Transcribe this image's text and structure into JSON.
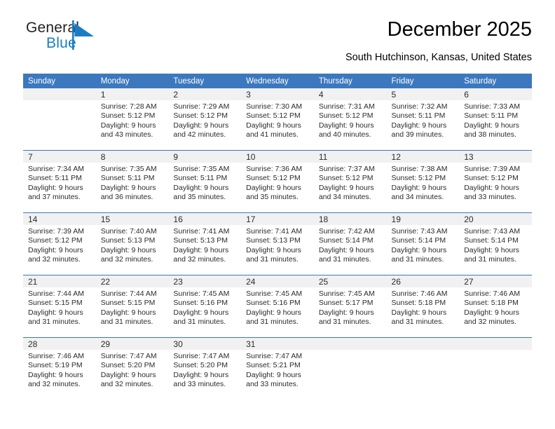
{
  "brand": {
    "name_part1": "General",
    "name_part2": "Blue",
    "logo_icon": "blue-triangle-flag-mark",
    "color_primary": "#1a7dc4",
    "color_dark": "#231f20"
  },
  "header": {
    "title": "December 2025",
    "subtitle": "South Hutchinson, Kansas, United States"
  },
  "calendar": {
    "header_bg": "#3c78be",
    "header_text_color": "#ffffff",
    "daynum_band_bg": "#f1f1f1",
    "row_divider_color": "#3c78be",
    "weekdays": [
      "Sunday",
      "Monday",
      "Tuesday",
      "Wednesday",
      "Thursday",
      "Friday",
      "Saturday"
    ],
    "weeks": [
      [
        {
          "day": "",
          "sunrise": "",
          "sunset": "",
          "daylight_line1": "",
          "daylight_line2": "",
          "empty": true
        },
        {
          "day": "1",
          "sunrise": "Sunrise: 7:28 AM",
          "sunset": "Sunset: 5:12 PM",
          "daylight_line1": "Daylight: 9 hours",
          "daylight_line2": "and 43 minutes."
        },
        {
          "day": "2",
          "sunrise": "Sunrise: 7:29 AM",
          "sunset": "Sunset: 5:12 PM",
          "daylight_line1": "Daylight: 9 hours",
          "daylight_line2": "and 42 minutes."
        },
        {
          "day": "3",
          "sunrise": "Sunrise: 7:30 AM",
          "sunset": "Sunset: 5:12 PM",
          "daylight_line1": "Daylight: 9 hours",
          "daylight_line2": "and 41 minutes."
        },
        {
          "day": "4",
          "sunrise": "Sunrise: 7:31 AM",
          "sunset": "Sunset: 5:12 PM",
          "daylight_line1": "Daylight: 9 hours",
          "daylight_line2": "and 40 minutes."
        },
        {
          "day": "5",
          "sunrise": "Sunrise: 7:32 AM",
          "sunset": "Sunset: 5:11 PM",
          "daylight_line1": "Daylight: 9 hours",
          "daylight_line2": "and 39 minutes."
        },
        {
          "day": "6",
          "sunrise": "Sunrise: 7:33 AM",
          "sunset": "Sunset: 5:11 PM",
          "daylight_line1": "Daylight: 9 hours",
          "daylight_line2": "and 38 minutes."
        }
      ],
      [
        {
          "day": "7",
          "sunrise": "Sunrise: 7:34 AM",
          "sunset": "Sunset: 5:11 PM",
          "daylight_line1": "Daylight: 9 hours",
          "daylight_line2": "and 37 minutes."
        },
        {
          "day": "8",
          "sunrise": "Sunrise: 7:35 AM",
          "sunset": "Sunset: 5:11 PM",
          "daylight_line1": "Daylight: 9 hours",
          "daylight_line2": "and 36 minutes."
        },
        {
          "day": "9",
          "sunrise": "Sunrise: 7:35 AM",
          "sunset": "Sunset: 5:11 PM",
          "daylight_line1": "Daylight: 9 hours",
          "daylight_line2": "and 35 minutes."
        },
        {
          "day": "10",
          "sunrise": "Sunrise: 7:36 AM",
          "sunset": "Sunset: 5:12 PM",
          "daylight_line1": "Daylight: 9 hours",
          "daylight_line2": "and 35 minutes."
        },
        {
          "day": "11",
          "sunrise": "Sunrise: 7:37 AM",
          "sunset": "Sunset: 5:12 PM",
          "daylight_line1": "Daylight: 9 hours",
          "daylight_line2": "and 34 minutes."
        },
        {
          "day": "12",
          "sunrise": "Sunrise: 7:38 AM",
          "sunset": "Sunset: 5:12 PM",
          "daylight_line1": "Daylight: 9 hours",
          "daylight_line2": "and 34 minutes."
        },
        {
          "day": "13",
          "sunrise": "Sunrise: 7:39 AM",
          "sunset": "Sunset: 5:12 PM",
          "daylight_line1": "Daylight: 9 hours",
          "daylight_line2": "and 33 minutes."
        }
      ],
      [
        {
          "day": "14",
          "sunrise": "Sunrise: 7:39 AM",
          "sunset": "Sunset: 5:12 PM",
          "daylight_line1": "Daylight: 9 hours",
          "daylight_line2": "and 32 minutes."
        },
        {
          "day": "15",
          "sunrise": "Sunrise: 7:40 AM",
          "sunset": "Sunset: 5:13 PM",
          "daylight_line1": "Daylight: 9 hours",
          "daylight_line2": "and 32 minutes."
        },
        {
          "day": "16",
          "sunrise": "Sunrise: 7:41 AM",
          "sunset": "Sunset: 5:13 PM",
          "daylight_line1": "Daylight: 9 hours",
          "daylight_line2": "and 32 minutes."
        },
        {
          "day": "17",
          "sunrise": "Sunrise: 7:41 AM",
          "sunset": "Sunset: 5:13 PM",
          "daylight_line1": "Daylight: 9 hours",
          "daylight_line2": "and 31 minutes."
        },
        {
          "day": "18",
          "sunrise": "Sunrise: 7:42 AM",
          "sunset": "Sunset: 5:14 PM",
          "daylight_line1": "Daylight: 9 hours",
          "daylight_line2": "and 31 minutes."
        },
        {
          "day": "19",
          "sunrise": "Sunrise: 7:43 AM",
          "sunset": "Sunset: 5:14 PM",
          "daylight_line1": "Daylight: 9 hours",
          "daylight_line2": "and 31 minutes."
        },
        {
          "day": "20",
          "sunrise": "Sunrise: 7:43 AM",
          "sunset": "Sunset: 5:14 PM",
          "daylight_line1": "Daylight: 9 hours",
          "daylight_line2": "and 31 minutes."
        }
      ],
      [
        {
          "day": "21",
          "sunrise": "Sunrise: 7:44 AM",
          "sunset": "Sunset: 5:15 PM",
          "daylight_line1": "Daylight: 9 hours",
          "daylight_line2": "and 31 minutes."
        },
        {
          "day": "22",
          "sunrise": "Sunrise: 7:44 AM",
          "sunset": "Sunset: 5:15 PM",
          "daylight_line1": "Daylight: 9 hours",
          "daylight_line2": "and 31 minutes."
        },
        {
          "day": "23",
          "sunrise": "Sunrise: 7:45 AM",
          "sunset": "Sunset: 5:16 PM",
          "daylight_line1": "Daylight: 9 hours",
          "daylight_line2": "and 31 minutes."
        },
        {
          "day": "24",
          "sunrise": "Sunrise: 7:45 AM",
          "sunset": "Sunset: 5:16 PM",
          "daylight_line1": "Daylight: 9 hours",
          "daylight_line2": "and 31 minutes."
        },
        {
          "day": "25",
          "sunrise": "Sunrise: 7:45 AM",
          "sunset": "Sunset: 5:17 PM",
          "daylight_line1": "Daylight: 9 hours",
          "daylight_line2": "and 31 minutes."
        },
        {
          "day": "26",
          "sunrise": "Sunrise: 7:46 AM",
          "sunset": "Sunset: 5:18 PM",
          "daylight_line1": "Daylight: 9 hours",
          "daylight_line2": "and 31 minutes."
        },
        {
          "day": "27",
          "sunrise": "Sunrise: 7:46 AM",
          "sunset": "Sunset: 5:18 PM",
          "daylight_line1": "Daylight: 9 hours",
          "daylight_line2": "and 32 minutes."
        }
      ],
      [
        {
          "day": "28",
          "sunrise": "Sunrise: 7:46 AM",
          "sunset": "Sunset: 5:19 PM",
          "daylight_line1": "Daylight: 9 hours",
          "daylight_line2": "and 32 minutes."
        },
        {
          "day": "29",
          "sunrise": "Sunrise: 7:47 AM",
          "sunset": "Sunset: 5:20 PM",
          "daylight_line1": "Daylight: 9 hours",
          "daylight_line2": "and 32 minutes."
        },
        {
          "day": "30",
          "sunrise": "Sunrise: 7:47 AM",
          "sunset": "Sunset: 5:20 PM",
          "daylight_line1": "Daylight: 9 hours",
          "daylight_line2": "and 33 minutes."
        },
        {
          "day": "31",
          "sunrise": "Sunrise: 7:47 AM",
          "sunset": "Sunset: 5:21 PM",
          "daylight_line1": "Daylight: 9 hours",
          "daylight_line2": "and 33 minutes."
        },
        {
          "day": "",
          "sunrise": "",
          "sunset": "",
          "daylight_line1": "",
          "daylight_line2": "",
          "empty": true
        },
        {
          "day": "",
          "sunrise": "",
          "sunset": "",
          "daylight_line1": "",
          "daylight_line2": "",
          "empty": true
        },
        {
          "day": "",
          "sunrise": "",
          "sunset": "",
          "daylight_line1": "",
          "daylight_line2": "",
          "empty": true
        }
      ]
    ]
  }
}
